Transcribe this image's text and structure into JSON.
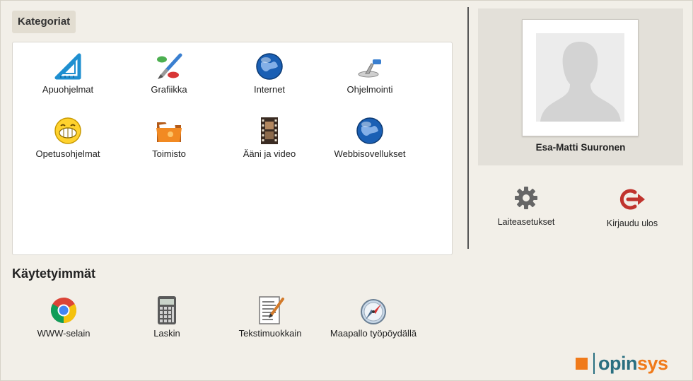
{
  "categories": {
    "title": "Kategoriat",
    "items": [
      {
        "label": "Apuohjelmat",
        "icon": "set-square-icon"
      },
      {
        "label": "Grafiikka",
        "icon": "paint-brush-icon"
      },
      {
        "label": "Internet",
        "icon": "globe-icon"
      },
      {
        "label": "Ohjelmointi",
        "icon": "toolbox-icon"
      },
      {
        "label": "Opetusohjelmat",
        "icon": "smiley-icon"
      },
      {
        "label": "Toimisto",
        "icon": "folder-icon"
      },
      {
        "label": "Ääni ja video",
        "icon": "film-strip-icon"
      },
      {
        "label": "Webbisovellukset",
        "icon": "globe-icon"
      }
    ]
  },
  "user": {
    "name": "Esa-Matti Suuronen",
    "avatar_icon": "avatar-silhouette-icon"
  },
  "actions": [
    {
      "label": "Laiteasetukset",
      "icon": "gear-icon"
    },
    {
      "label": "Kirjaudu ulos",
      "icon": "logout-icon"
    }
  ],
  "recent": {
    "title": "Käytetyimmät",
    "items": [
      {
        "label": "WWW-selain",
        "icon": "chrome-icon"
      },
      {
        "label": "Laskin",
        "icon": "calculator-icon"
      },
      {
        "label": "Tekstimuokkain",
        "icon": "text-editor-icon"
      },
      {
        "label": "Maapallo työpöydällä",
        "icon": "compass-icon"
      }
    ]
  },
  "brand": {
    "part1": "opin",
    "part2": "sys",
    "color_primary": "#2a6f80",
    "color_accent": "#f07a1a"
  }
}
